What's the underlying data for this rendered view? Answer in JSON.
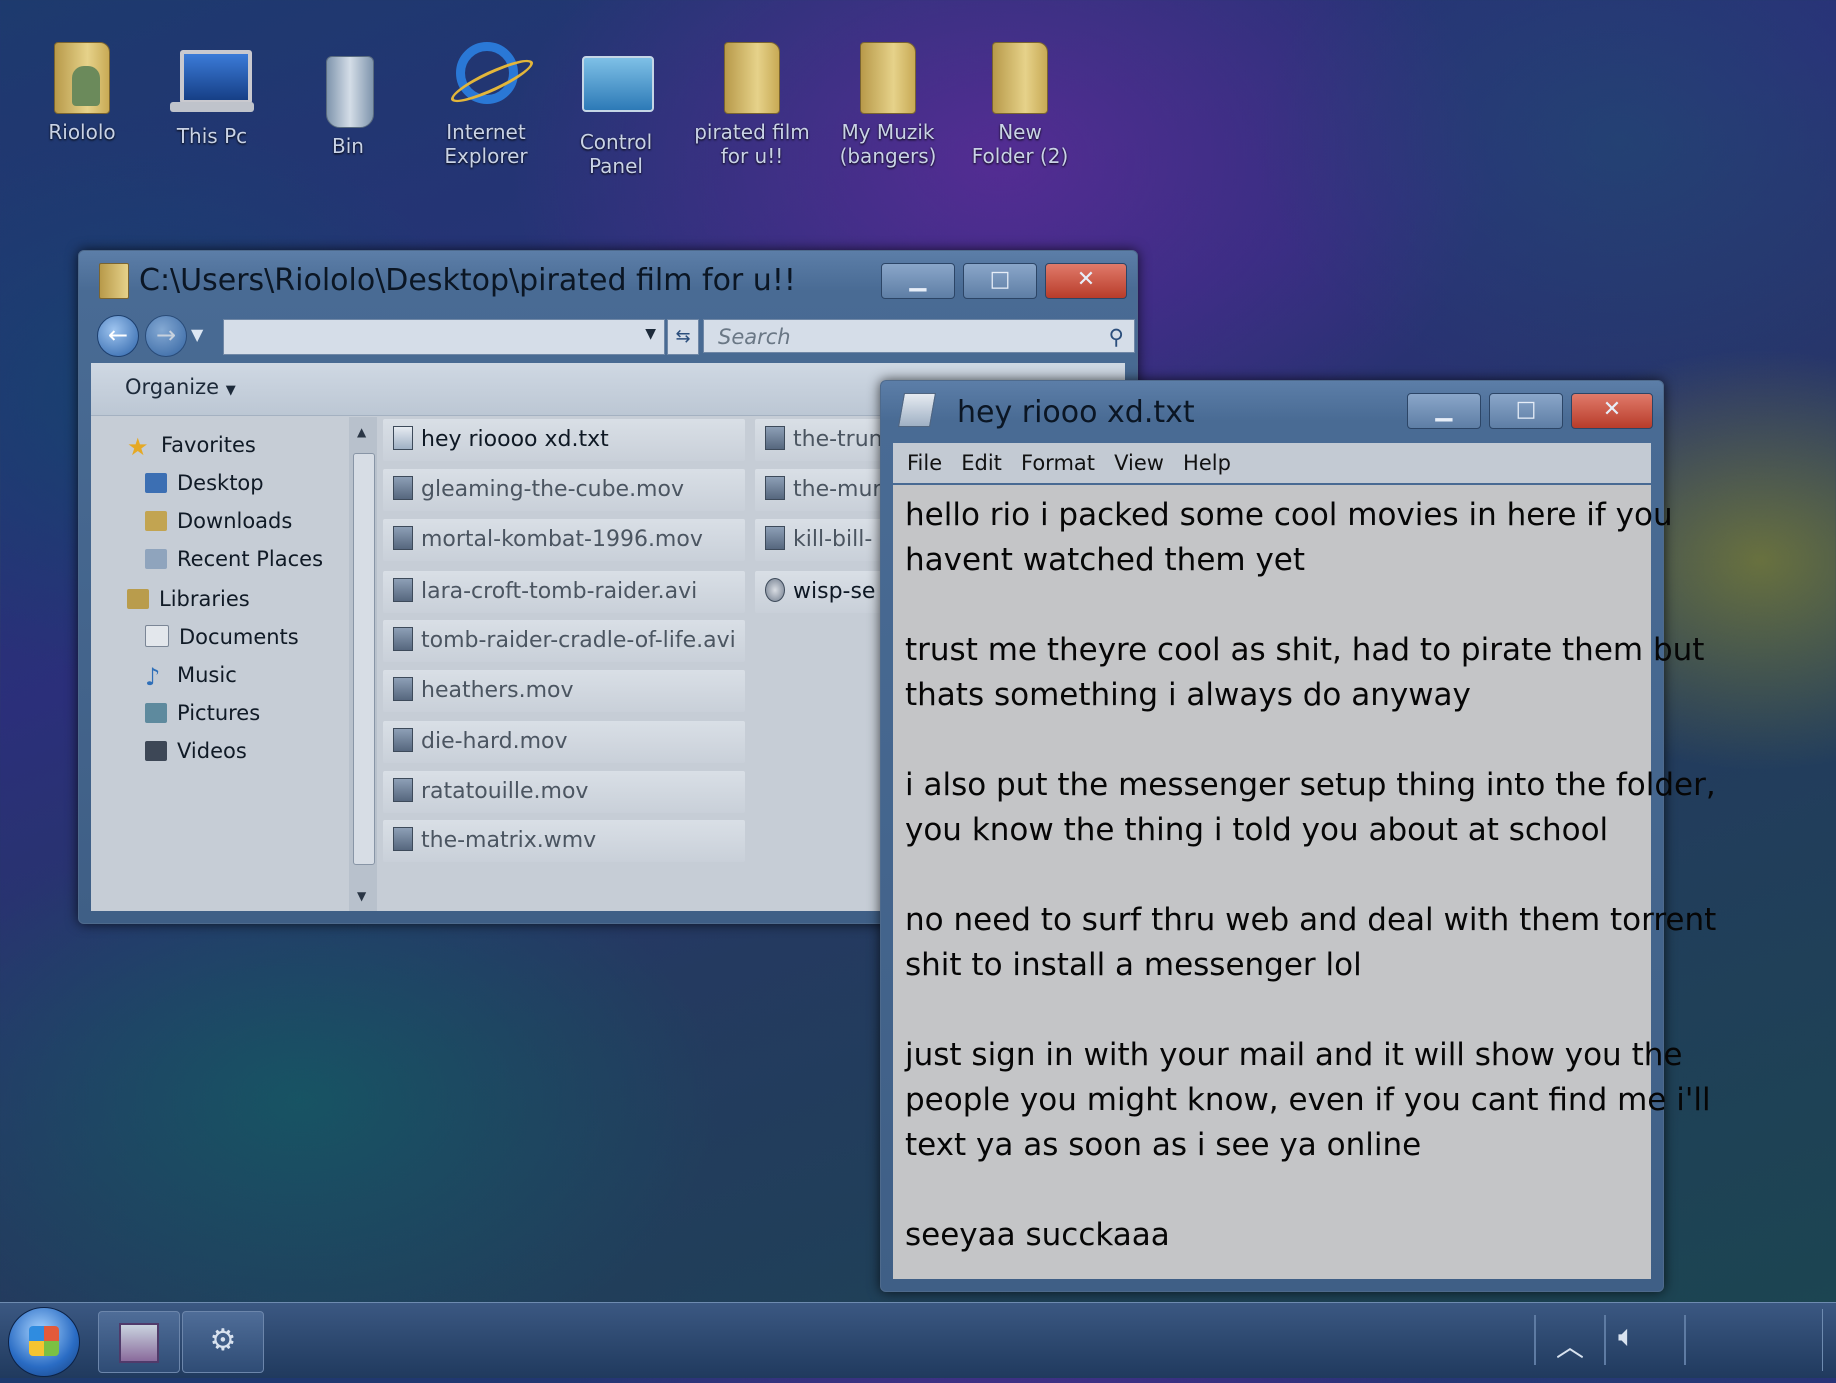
{
  "desktop_icons": [
    {
      "label": "Riololo",
      "icon": "user-folder-icon"
    },
    {
      "label": "This Pc",
      "icon": "computer-icon"
    },
    {
      "label": "Bin",
      "icon": "recycle-bin-icon"
    },
    {
      "label": "Internet Explorer",
      "icon": "internet-explorer-icon"
    },
    {
      "label": "Control Panel",
      "icon": "control-panel-icon"
    },
    {
      "label": "pirated film for u!!",
      "icon": "folder-icon"
    },
    {
      "label": "My Muzik (bangers)",
      "icon": "music-folder-icon"
    },
    {
      "label": "New Folder (2)",
      "icon": "folder-icon"
    }
  ],
  "explorer": {
    "title": "C:\\Users\\Riololo\\Desktop\\pirated film for u!!",
    "search_placeholder": "Search",
    "organize_label": "Organize",
    "tree": [
      {
        "label": "Favorites",
        "icon": "star-icon"
      },
      {
        "label": "Desktop",
        "icon": "desktop-icon"
      },
      {
        "label": "Downloads",
        "icon": "downloads-icon"
      },
      {
        "label": "Recent Places",
        "icon": "recent-places-icon"
      },
      {
        "label": "Libraries",
        "icon": "libraries-icon"
      },
      {
        "label": "Documents",
        "icon": "documents-icon"
      },
      {
        "label": "Music",
        "icon": "music-icon"
      },
      {
        "label": "Pictures",
        "icon": "pictures-icon"
      },
      {
        "label": "Videos",
        "icon": "videos-icon"
      }
    ],
    "files_col1": [
      "hey rioooo xd.txt",
      "gleaming-the-cube.mov",
      "mortal-kombat-1996.mov",
      "lara-croft-tomb-raider.avi",
      "tomb-raider-cradle-of-life.avi",
      "heathers.mov",
      "die-hard.mov",
      "ratatouille.mov",
      "the-matrix.wmv"
    ],
    "files_col2": [
      "the-trun",
      "the-mur",
      "kill-bill-",
      "wisp-se"
    ]
  },
  "notepad": {
    "title": "hey riooo xd.txt",
    "menu": [
      "File",
      "Edit",
      "Format",
      "View",
      "Help"
    ],
    "lines": [
      "hello rio i packed some cool movies in here if you",
      "havent watched them yet",
      "trust me theyre cool as shit, had to pirate them but",
      "thats something i always do anyway",
      "i also put the messenger setup thing into the folder,",
      "you know the thing i told you about at school",
      "no need to surf thru web and deal with them torrent",
      "shit to install a messenger lol",
      "just sign in with your mail and it will show you the",
      "people you might know, even if you cant find me i'll",
      "text ya as soon as i see ya online",
      "seeyaa succkaaa"
    ]
  },
  "taskbar": {
    "buttons": [
      "save-disk-icon",
      "settings-gear-icon"
    ],
    "tray": [
      "show-hidden-icons-chevron",
      "volume-icon"
    ]
  },
  "colors": {
    "close_button": "#c0493a",
    "titlebar": "#5c7ea8",
    "taskbar": "#203a5e"
  }
}
